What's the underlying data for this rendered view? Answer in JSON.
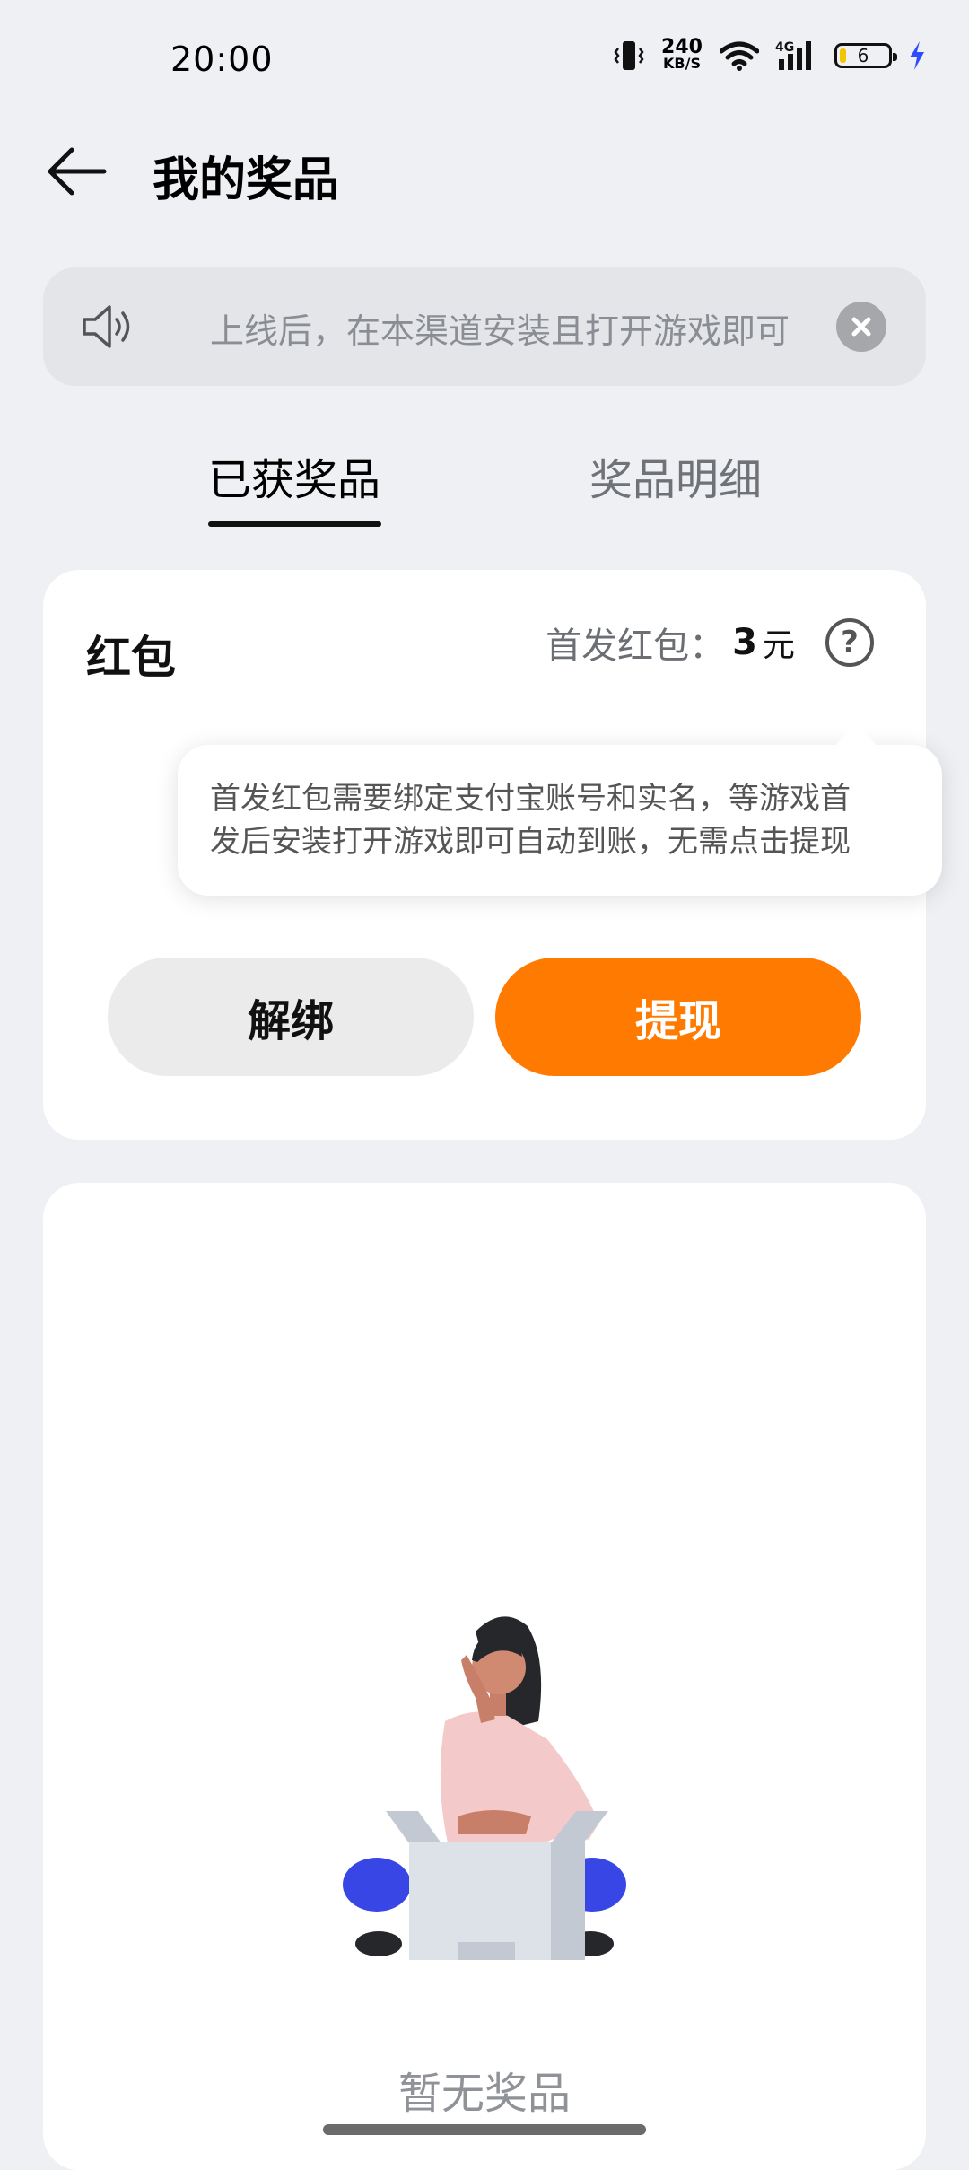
{
  "status_bar": {
    "time": "20:00",
    "speed_value": "240",
    "speed_unit": "KB/S",
    "network": "4G",
    "battery": "6",
    "icons": [
      "vibrate-icon",
      "wifi-icon",
      "signal-icon",
      "battery-icon",
      "charging-icon"
    ]
  },
  "header": {
    "title": "我的奖品",
    "back_icon": "arrow-left-icon"
  },
  "notice": {
    "text": "上线后，在本渠道安装且打开游戏即可",
    "icon": "speaker-icon",
    "close_icon": "close-icon"
  },
  "tabs": [
    {
      "label": "已获奖品",
      "active": true
    },
    {
      "label": "奖品明细",
      "active": false
    }
  ],
  "red_packet": {
    "title": "红包",
    "info_label": "首发红包：",
    "amount": "3",
    "unit": "元",
    "help_icon": "question-icon",
    "help_glyph": "?",
    "unbind_label": "解绑",
    "withdraw_label": "提现"
  },
  "tooltip": {
    "line1": "首发红包需要绑定支付宝账号和实名，等游戏首",
    "line2": "发后安装打开游戏即可自动到账，无需点击提现"
  },
  "empty": {
    "text": "暂无奖品",
    "illustration": "person-with-empty-box"
  },
  "colors": {
    "accent": "#ff7a00",
    "background": "#eef0f3",
    "card": "#ffffff"
  }
}
